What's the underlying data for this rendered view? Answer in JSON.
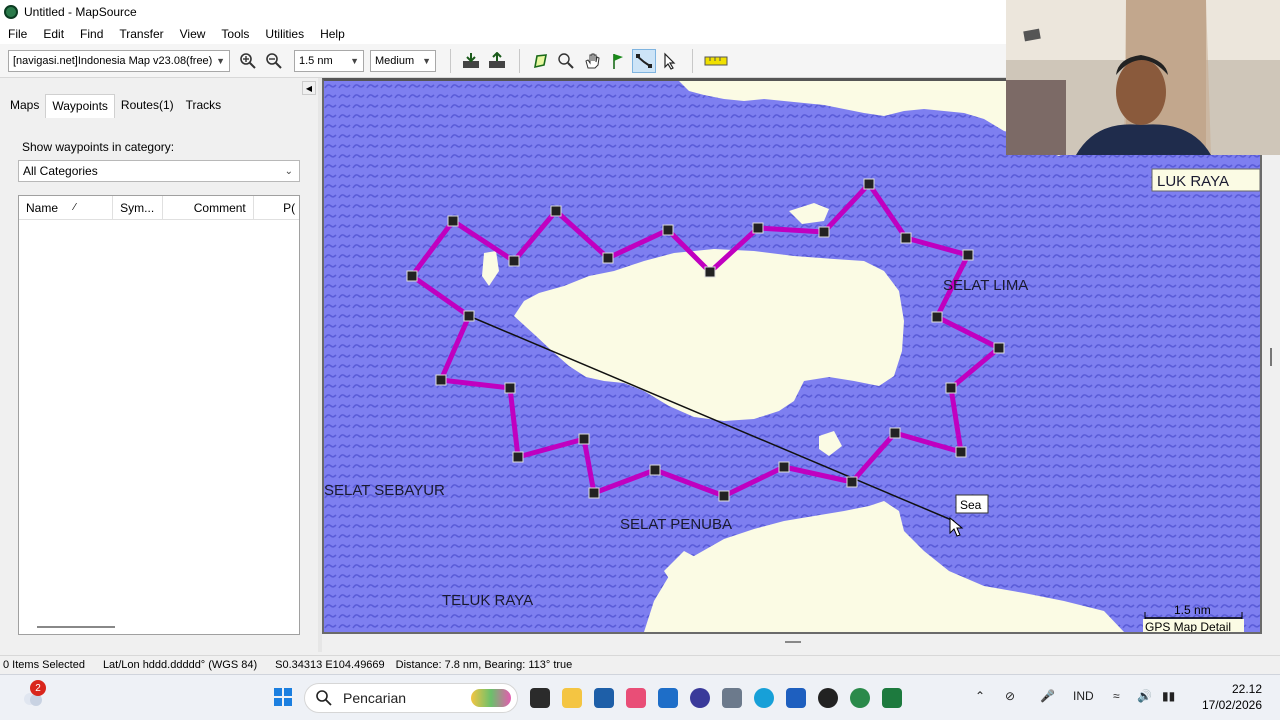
{
  "window": {
    "title": "Untitled - MapSource"
  },
  "menu": [
    "File",
    "Edit",
    "Find",
    "Transfer",
    "View",
    "Tools",
    "Utilities",
    "Help"
  ],
  "toolbar": {
    "map_product": "[navigasi.net]Indonesia Map v23.08(free)",
    "zoom_scale": "1.5 nm",
    "detail": "Medium",
    "icons": [
      "zoom-in-icon",
      "zoom-out-icon",
      "receive-from-device-icon",
      "send-to-device-icon",
      "waypoint-tool-icon",
      "zoom-tool-icon",
      "pan-hand-icon",
      "flag-tool-icon",
      "route-tool-icon",
      "select-pointer-icon",
      "distance-ruler-icon"
    ]
  },
  "left_panel": {
    "tabs": [
      "Maps",
      "Waypoints",
      "Routes(1)",
      "Tracks"
    ],
    "active_tab": "Waypoints",
    "category_label": "Show waypoints in category:",
    "category_value": "All Categories",
    "columns": [
      "Name",
      "Sym...",
      "Comment",
      "P("
    ],
    "sort_indicator": "⁄"
  },
  "map": {
    "labels": [
      "LUK RAYA",
      "SELAT LIMA",
      "SELAT SEBAYUR",
      "SELAT PENUBA",
      "TELUK RAYA"
    ],
    "tooltip": "Sea",
    "scale_text": "1.5 nm",
    "detail_badge": "GPS Map Detail",
    "route_color": "#c000c0",
    "water_color": "#7e7ff0",
    "land_color": "#fbfbe4"
  },
  "status": {
    "selected": "0 Items Selected",
    "format": "Lat/Lon hddd.ddddd° (WGS 84)",
    "position": "S0.34313 E104.49669",
    "distance": "Distance: 7.8 nm, Bearing: 113° true"
  },
  "taskbar": {
    "notification_count": "2",
    "search_placeholder": "Pencarian",
    "language": "IND",
    "time": "22.12",
    "date": "17/02/2026"
  }
}
